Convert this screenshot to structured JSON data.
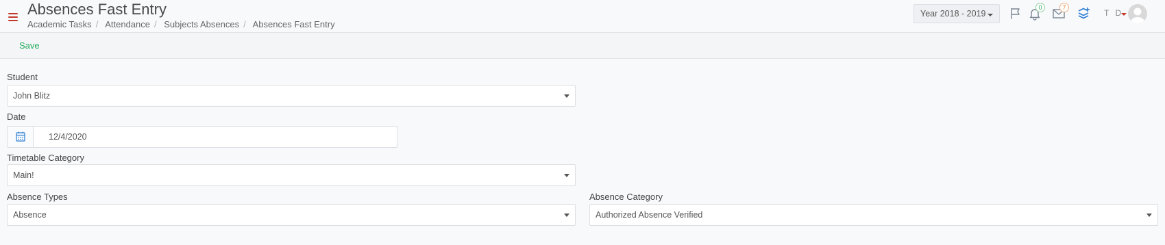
{
  "header": {
    "title": "Absences Fast Entry",
    "breadcrumb": [
      "Academic Tasks",
      "Attendance",
      "Subjects Absences",
      "Absences Fast Entry"
    ],
    "year_select": "Year 2018 - 2019",
    "notifications_count": "0",
    "messages_count": "7",
    "user_initials": "T D",
    "icons": [
      "menu-icon",
      "flag-icon",
      "bell-icon",
      "envelope-icon",
      "layers-add-icon",
      "avatar"
    ]
  },
  "toolbar": {
    "save_label": "Save"
  },
  "form": {
    "student": {
      "label": "Student",
      "value": "John Blitz"
    },
    "date": {
      "label": "Date",
      "value": "12/4/2020"
    },
    "timetable_category": {
      "label": "Timetable Category",
      "value": "Main!"
    },
    "absence_types": {
      "label": "Absence Types",
      "value": "Absence"
    },
    "absence_category": {
      "label": "Absence Category",
      "value": "Authorized Absence Verified"
    }
  },
  "colors": {
    "accent_red": "#c0392b",
    "save_green": "#27ae60",
    "icon_blue": "#2a7bd4"
  }
}
